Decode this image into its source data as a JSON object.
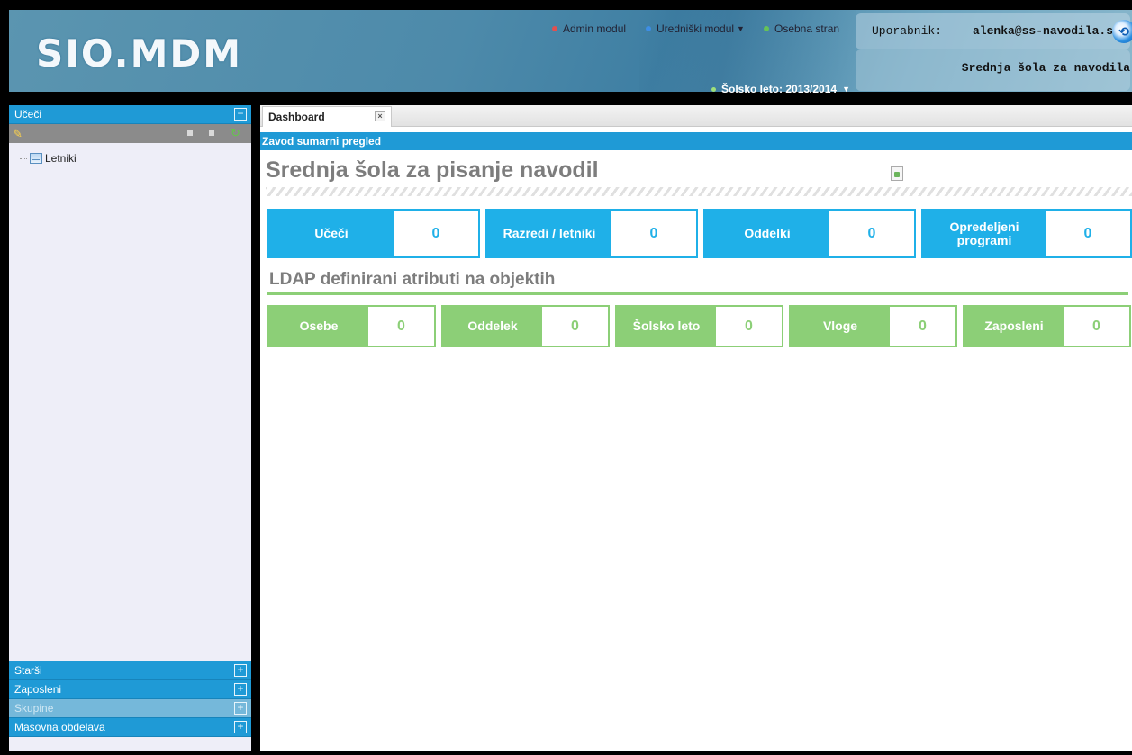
{
  "header": {
    "logo": "SIO.MDM",
    "nav": [
      {
        "label": "Admin modul",
        "color": "#d83a3a",
        "dropdown": false
      },
      {
        "label": "Uredniški modul",
        "color": "#2f7fd6",
        "dropdown": true
      },
      {
        "label": "Osebna stran",
        "color": "#58b84a",
        "dropdown": false
      }
    ],
    "user_label": "Uporabnik:",
    "user_email": "alenka@ss-navodila.si",
    "school_name": "Srednja šola za navodila",
    "school_year": "Šolsko leto: 2013/2014",
    "logout_icon": "logout-icon"
  },
  "sidebar": {
    "top_section": "Učeči",
    "tree_root": "Letniki",
    "bottom_sections": [
      "Starši",
      "Zaposleni",
      "Skupine",
      "Masovna obdelava"
    ]
  },
  "main": {
    "tab": "Dashboard",
    "panel_title": "Zavod sumarni pregled",
    "org_name": "Srednja šola za pisanje navodil",
    "blue_cards": [
      {
        "label": "Učeči",
        "value": "0"
      },
      {
        "label": "Razredi / letniki",
        "value": "0"
      },
      {
        "label": "Oddelki",
        "value": "0"
      },
      {
        "label": "Opredeljeni programi",
        "value": "0"
      }
    ],
    "ldap_title": "LDAP definirani atributi na objektih",
    "green_cards": [
      {
        "label": "Osebe",
        "value": "0"
      },
      {
        "label": "Oddelek",
        "value": "0"
      },
      {
        "label": "Šolsko leto",
        "value": "0"
      },
      {
        "label": "Vloge",
        "value": "0"
      },
      {
        "label": "Zaposleni",
        "value": "0"
      }
    ],
    "colors": {
      "blue": "#1fb0e8",
      "green": "#8ccf77"
    }
  }
}
